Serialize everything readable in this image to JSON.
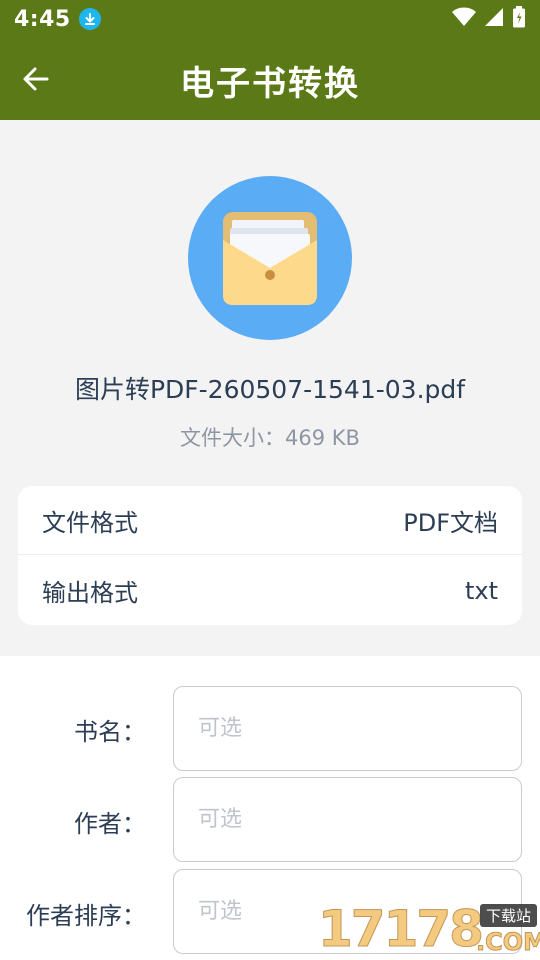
{
  "status_bar": {
    "time": "4:45",
    "icons": [
      "download-icon",
      "wifi-icon",
      "signal-icon",
      "battery-icon"
    ],
    "color": "#5b7a17"
  },
  "app_bar": {
    "title": "电子书转换",
    "back_icon": "arrow-left-icon"
  },
  "file": {
    "icon": "folder-documents-icon",
    "icon_bg_color": "#5aacf5",
    "name": "图片转PDF-260507-1541-03.pdf",
    "size_label": "文件大小：",
    "size_value": "469 KB"
  },
  "formats": [
    {
      "label": "文件格式",
      "value": "PDF文档"
    },
    {
      "label": "输出格式",
      "value": "txt"
    }
  ],
  "form": {
    "fields": [
      {
        "label": "书名：",
        "placeholder": "可选",
        "value": ""
      },
      {
        "label": "作者：",
        "placeholder": "可选",
        "value": ""
      },
      {
        "label": "作者排序：",
        "placeholder": "可选",
        "value": ""
      }
    ]
  },
  "watermark": {
    "number": "17178",
    "tag": "下载站",
    "domain": ".COM"
  }
}
